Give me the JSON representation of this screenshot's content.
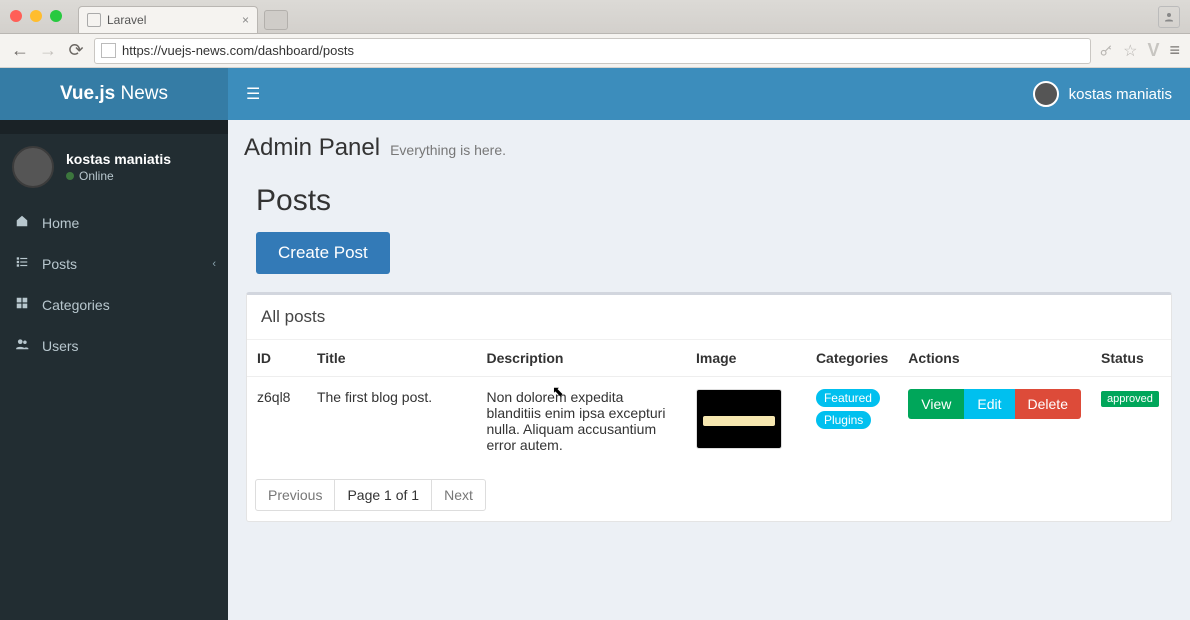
{
  "browser": {
    "tab_title": "Laravel",
    "url": "https://vuejs-news.com/dashboard/posts"
  },
  "brand": {
    "bold": "Vue.js",
    "light": " News"
  },
  "topbar_user": "kostas maniatis",
  "sidebar": {
    "user": {
      "name": "kostas maniatis",
      "status": "Online"
    },
    "items": [
      {
        "icon": "home-icon",
        "label": "Home"
      },
      {
        "icon": "list-icon",
        "label": "Posts",
        "arrow": true
      },
      {
        "icon": "grid-icon",
        "label": "Categories"
      },
      {
        "icon": "users-icon",
        "label": "Users"
      }
    ]
  },
  "header": {
    "title": "Admin Panel",
    "subtitle": "Everything is here."
  },
  "page": {
    "title": "Posts",
    "create_label": "Create Post",
    "panel_title": "All posts"
  },
  "table": {
    "columns": [
      "ID",
      "Title",
      "Description",
      "Image",
      "Categories",
      "Actions",
      "Status"
    ],
    "rows": [
      {
        "id": "z6ql8",
        "title": "The first blog post.",
        "description": "Non dolorem expedita blanditiis enim ipsa excepturi nulla. Aliquam accusantium error autem.",
        "categories": [
          "Featured",
          "Plugins"
        ],
        "actions": {
          "view": "View",
          "edit": "Edit",
          "delete": "Delete"
        },
        "status": "approved"
      }
    ]
  },
  "pagination": {
    "prev": "Previous",
    "info": "Page 1 of 1",
    "next": "Next"
  }
}
